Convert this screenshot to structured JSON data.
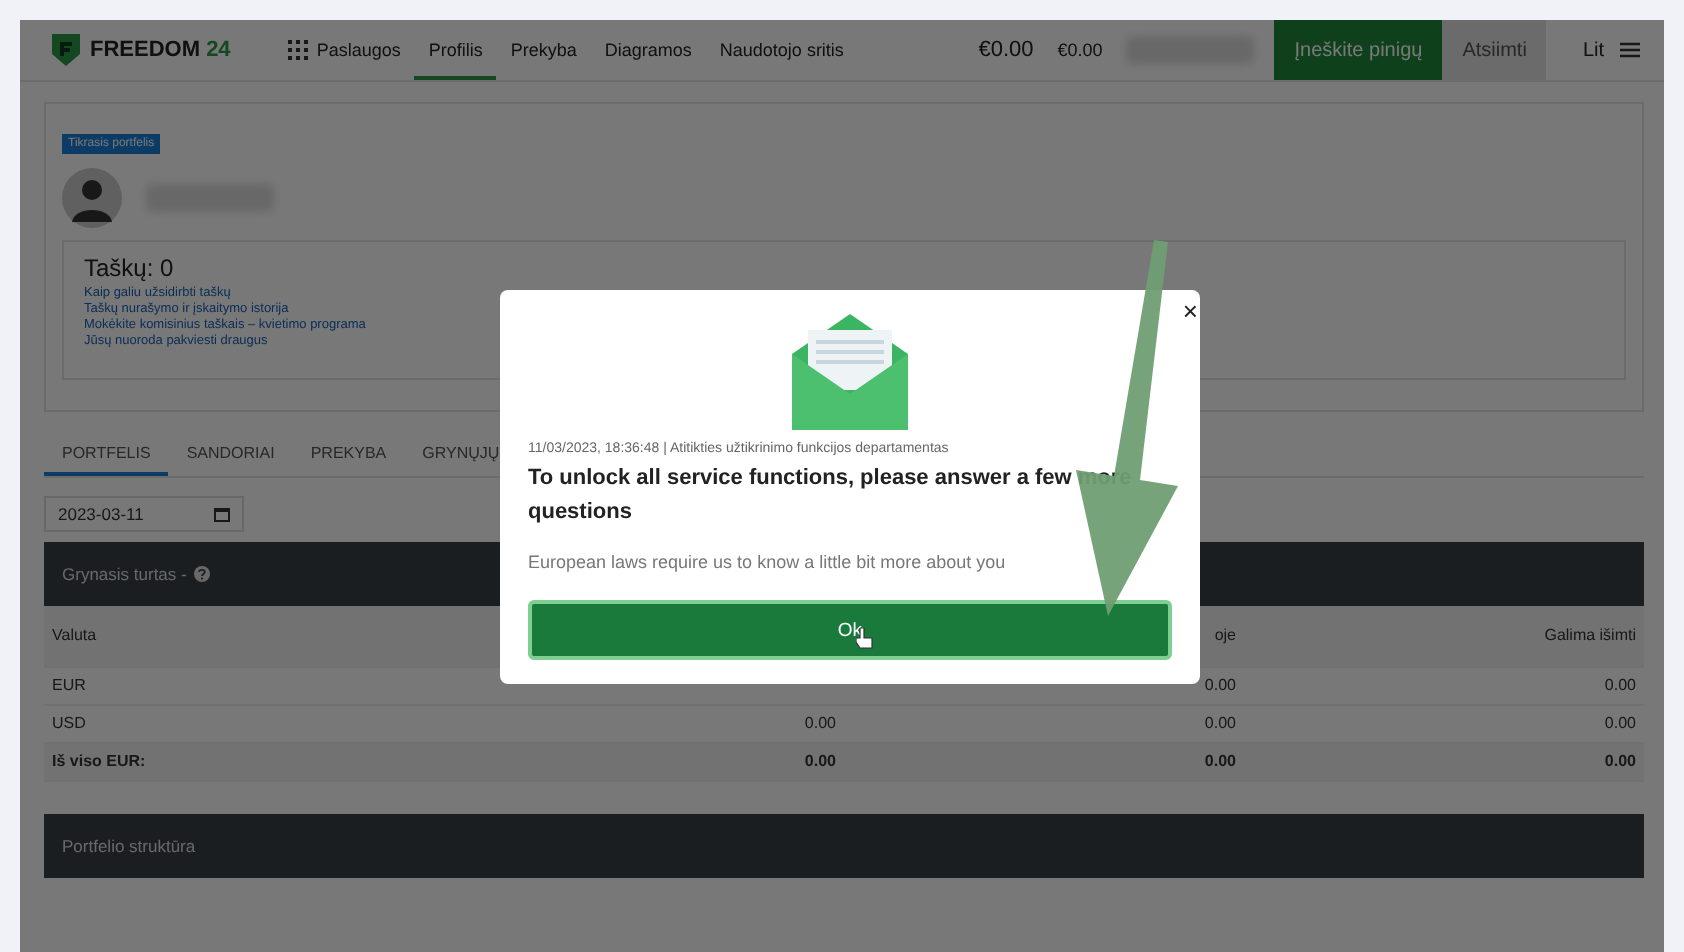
{
  "header": {
    "logo": {
      "name": "FREEDOM",
      "number": "24"
    },
    "nav": [
      {
        "label": "Paslaugos",
        "selected": false,
        "kind": "grid"
      },
      {
        "label": "Profilis",
        "selected": true,
        "kind": "plain"
      },
      {
        "label": "Prekyba",
        "selected": false,
        "kind": "plain"
      },
      {
        "label": "Diagramos",
        "selected": false,
        "kind": "plain"
      },
      {
        "label": "Naudotojo sritis",
        "selected": false,
        "kind": "plain"
      }
    ],
    "balance": "€0.00",
    "balance_small": "€0.00",
    "deposit_button": "Įneškite pinigų",
    "withdraw_button": "Atsiimti",
    "language": "Lit"
  },
  "profile": {
    "badge": "Tikrasis portfelis",
    "points": "Taškų: 0",
    "links": [
      "Kaip galiu užsidirbti taškų",
      "Taškų nurašymo ir įskaitymo istorija",
      "Mokėkite komisinius taškais – kvietimo programa",
      "Jūsų nuoroda pakviesti draugus"
    ]
  },
  "tabs": [
    {
      "label": "PORTFELIS",
      "selected": true
    },
    {
      "label": "SANDORIAI",
      "selected": false
    },
    {
      "label": "PREKYBA",
      "selected": false
    },
    {
      "label": "GRYNŲJŲ",
      "selected": false
    }
  ],
  "date_field": {
    "value": "2023-03-11"
  },
  "net_worth": {
    "title": "Grynasis turtas  -",
    "columns": [
      "Valuta",
      null,
      "oje",
      "Galima išimti"
    ],
    "rows": [
      {
        "cells": [
          "EUR",
          null,
          "0.00",
          "0.00"
        ],
        "total": false
      },
      {
        "cells": [
          "USD",
          "0.00",
          "0.00",
          "0.00"
        ],
        "total": false
      },
      {
        "cells": [
          "Iš viso EUR:",
          "0.00",
          "0.00",
          "0.00"
        ],
        "total": true
      }
    ]
  },
  "structure": {
    "title": "Portfelio struktūra"
  },
  "modal": {
    "meta": "11/03/2023, 18:36:48",
    "separator": "|",
    "department": "Atitikties užtikrinimo funkcijos departamentas",
    "title": "To unlock all service functions, please answer a few more questions",
    "text": "European laws require us to know a little bit more about you",
    "button": "Ok",
    "close": "×"
  }
}
